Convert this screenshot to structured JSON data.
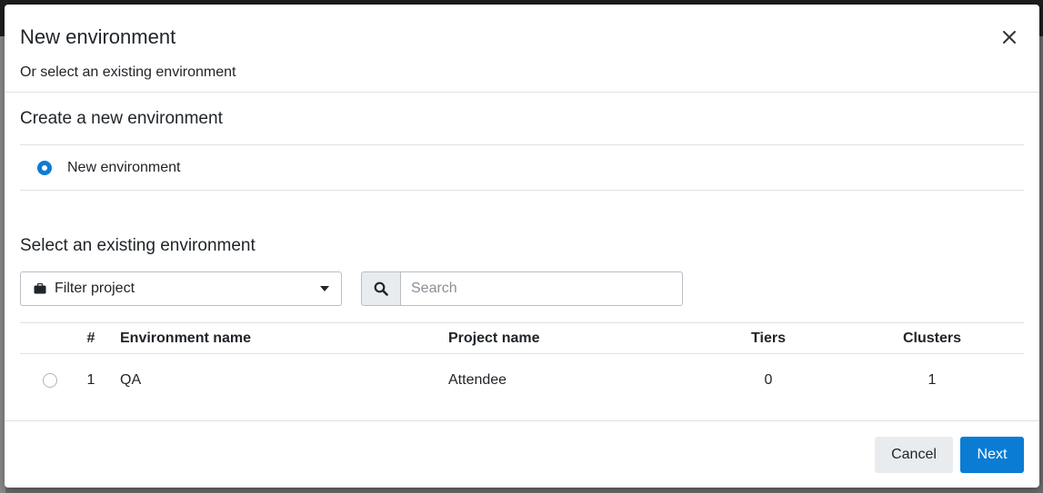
{
  "modal": {
    "title": "New environment",
    "subtitle": "Or select an existing environment",
    "close_icon": "close-icon"
  },
  "create_section": {
    "title": "Create a new environment",
    "option_label": "New environment",
    "option_selected": true
  },
  "existing_section": {
    "title": "Select an existing environment",
    "filter": {
      "icon": "briefcase-icon",
      "label": "Filter project",
      "caret_icon": "caret-down-icon"
    },
    "search": {
      "icon": "search-icon",
      "placeholder": "Search",
      "value": ""
    },
    "table": {
      "columns": [
        "#",
        "Environment name",
        "Project name",
        "Tiers",
        "Clusters"
      ],
      "rows": [
        {
          "num": "1",
          "environment": "QA",
          "project": "Attendee",
          "tiers": "0",
          "clusters": "1",
          "selected": false
        }
      ]
    }
  },
  "footer": {
    "cancel_label": "Cancel",
    "next_label": "Next"
  },
  "colors": {
    "primary": "#0a7cd4",
    "secondary_button": "#e9ecef",
    "border": "#dee2e6"
  }
}
